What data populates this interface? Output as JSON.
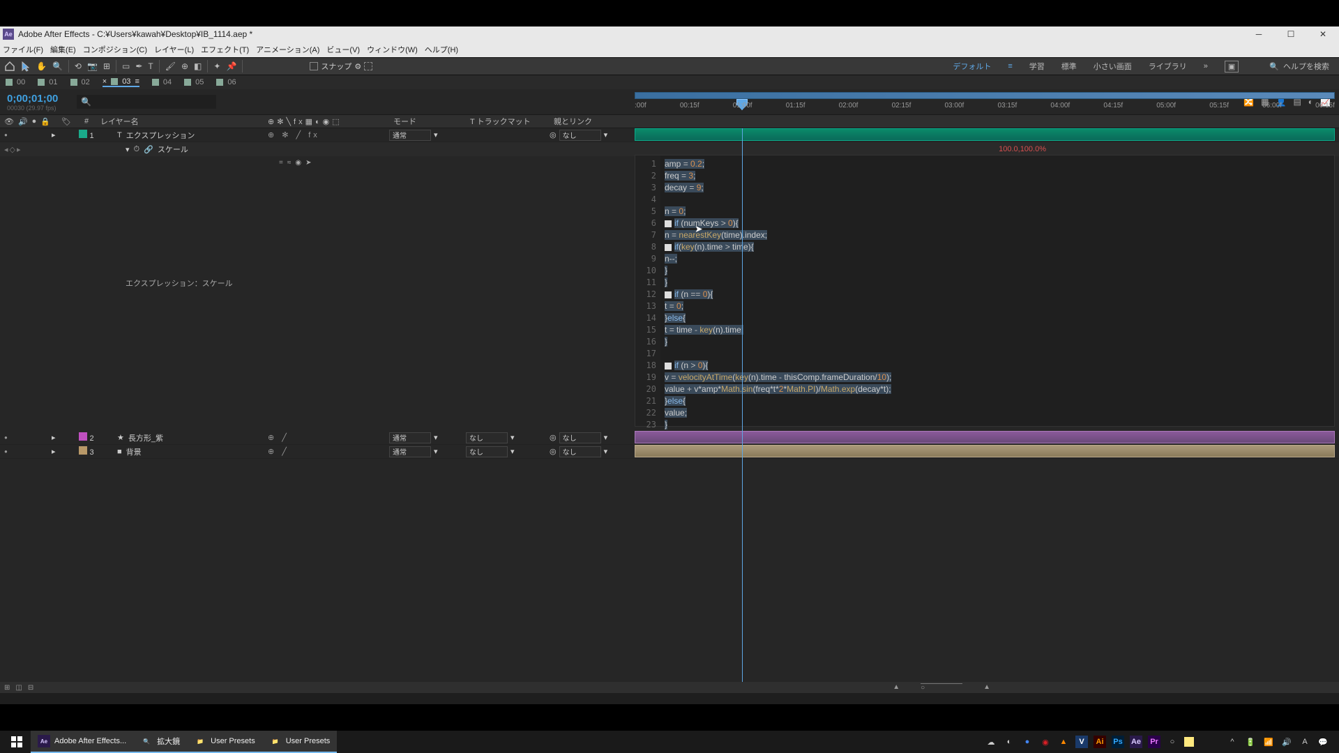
{
  "title": "Adobe After Effects - C:¥Users¥kawah¥Desktop¥IB_1114.aep *",
  "menu": [
    "ファイル(F)",
    "編集(E)",
    "コンポジション(C)",
    "レイヤー(L)",
    "エフェクト(T)",
    "アニメーション(A)",
    "ビュー(V)",
    "ウィンドウ(W)",
    "ヘルプ(H)"
  ],
  "snap_label": "スナップ",
  "workspaces": {
    "default": "デフォルト",
    "learn": "学習",
    "standard": "標準",
    "small": "小さい画面",
    "library": "ライブラリ"
  },
  "search_placeholder": "ヘルプを検索",
  "comp_tabs": [
    "00",
    "01",
    "02",
    "03",
    "04",
    "05",
    "06"
  ],
  "active_tab": "03",
  "timecode": "0;00;01;00",
  "fps": "00030 (29.97 fps)",
  "col": {
    "num": "#",
    "name": "レイヤー名",
    "mode": "モード",
    "track": "T トラックマット",
    "parent": "親とリンク"
  },
  "ruler_ticks": [
    ":00f",
    "00:15f",
    "01:00f",
    "01:15f",
    "02:00f",
    "02:15f",
    "03:00f",
    "03:15f",
    "04:00f",
    "04:15f",
    "05:00f",
    "05:15f",
    "06:00f",
    "06:15f"
  ],
  "layers": [
    {
      "idx": "1",
      "name": "エクスプレッション",
      "color": "#1aaa8a",
      "type": "T",
      "mode": "通常",
      "track": "",
      "parent": "なし",
      "switches": "⊕ ✻ ╱ fx"
    },
    {
      "idx": "2",
      "name": "長方形_紫",
      "color": "#c050c0",
      "type": "★",
      "mode": "通常",
      "track": "なし",
      "parent": "なし",
      "switches": "⊕   ╱"
    },
    {
      "idx": "3",
      "name": "背景",
      "color": "#b89868",
      "type": "■",
      "mode": "通常",
      "track": "なし",
      "parent": "なし",
      "switches": "⊕   ╱"
    }
  ],
  "property": {
    "name": "スケール",
    "value": "100.0,100.0%",
    "expr_label": "エクスプレッション：スケール",
    "buttons": "= ≈ ◉ ➤"
  },
  "code_lines": [
    "amp = 0.2;",
    "freq = 3;",
    "decay = 9;",
    "",
    "n = 0;",
    "if (numKeys > 0){",
    "n = nearestKey(time).index;",
    "if(key(n).time > time){",
    "n--;",
    "}",
    "}",
    "if (n == 0){",
    "t = 0;",
    "}else{",
    "t = time - key(n).time;",
    "}",
    "",
    "if (n > 0){",
    "v = velocityAtTime(key(n).time - thisComp.frameDuration/10);",
    "value + v*amp*Math.sin(freq*t*2*Math.PI)/Math.exp(decay*t);",
    "}else{",
    "value;",
    "}"
  ],
  "taskbar": {
    "ae": "Adobe After Effects...",
    "mag": "拡大鏡",
    "up1": "User Presets",
    "up2": "User Presets"
  }
}
